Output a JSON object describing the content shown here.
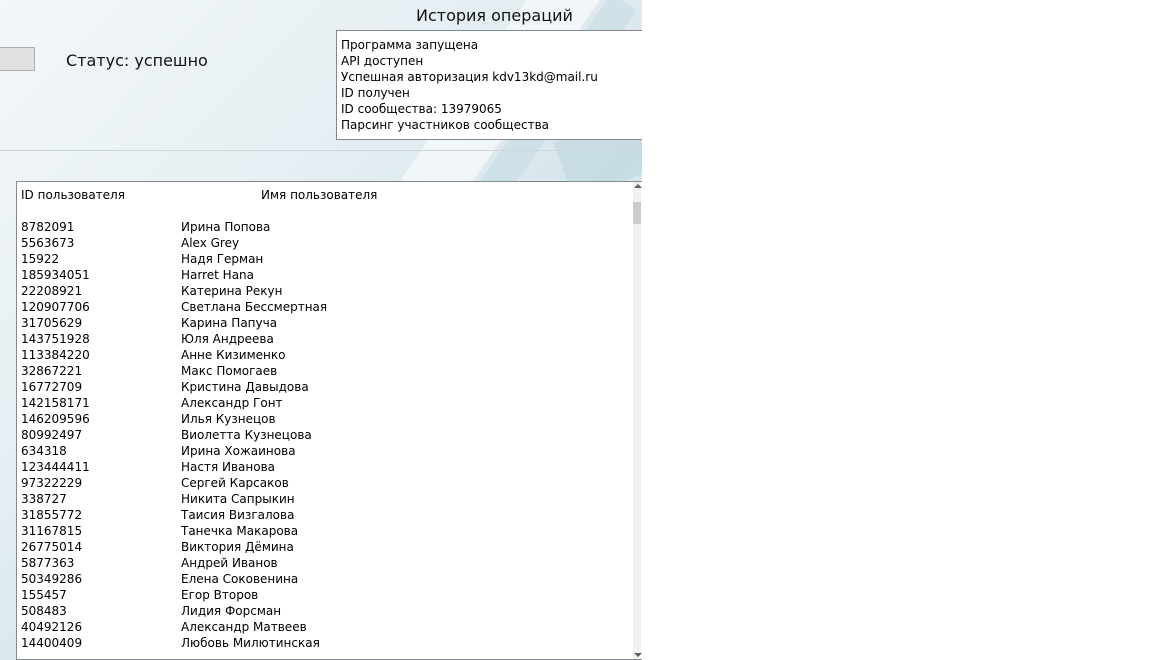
{
  "status": {
    "text": "Статус: успешно"
  },
  "log": {
    "title": "История операций",
    "lines": [
      "Программа запущена",
      "API доступен",
      "Успешная авторизация kdv13kd@mail.ru",
      "ID получен",
      "ID сообщества: 13979065",
      "Парсинг участников сообщества"
    ]
  },
  "users": {
    "columns": [
      "ID пользователя",
      "Имя пользователя"
    ],
    "rows": [
      {
        "id": "8782091",
        "name": "Ирина Попова"
      },
      {
        "id": "5563673",
        "name": "Alex Grey"
      },
      {
        "id": "15922",
        "name": "Надя Герман"
      },
      {
        "id": "185934051",
        "name": "Harret Hana"
      },
      {
        "id": "22208921",
        "name": "Катерина Рекун"
      },
      {
        "id": "120907706",
        "name": "Светлана Бессмертная"
      },
      {
        "id": "31705629",
        "name": "Карина Папуча"
      },
      {
        "id": "143751928",
        "name": "Юля Андреева"
      },
      {
        "id": "113384220",
        "name": "Анне Кизименко"
      },
      {
        "id": "32867221",
        "name": "Макс Помогаев"
      },
      {
        "id": "16772709",
        "name": "Кристина Давыдова"
      },
      {
        "id": "142158171",
        "name": "Александр Гонт"
      },
      {
        "id": "146209596",
        "name": "Илья Кузнецов"
      },
      {
        "id": "80992497",
        "name": "Виолетта Кузнецова"
      },
      {
        "id": "634318",
        "name": "Ирина Хожаинова"
      },
      {
        "id": "123444411",
        "name": "Настя Иванова"
      },
      {
        "id": "97322229",
        "name": "Сергей Карсаков"
      },
      {
        "id": "338727",
        "name": "Никита Сапрыкин"
      },
      {
        "id": "31855772",
        "name": "Таисия Визгалова"
      },
      {
        "id": "31167815",
        "name": "Танечка Макарова"
      },
      {
        "id": "26775014",
        "name": "Виктория Дёмина"
      },
      {
        "id": "5877363",
        "name": "Андрей Иванов"
      },
      {
        "id": "50349286",
        "name": "Елена Соковенина"
      },
      {
        "id": "155457",
        "name": "Егор Второв"
      },
      {
        "id": "508483",
        "name": "Лидия Форсман"
      },
      {
        "id": "40492126",
        "name": "Александр Матвеев"
      },
      {
        "id": "14400409",
        "name": "Любовь Милютинская"
      }
    ]
  }
}
